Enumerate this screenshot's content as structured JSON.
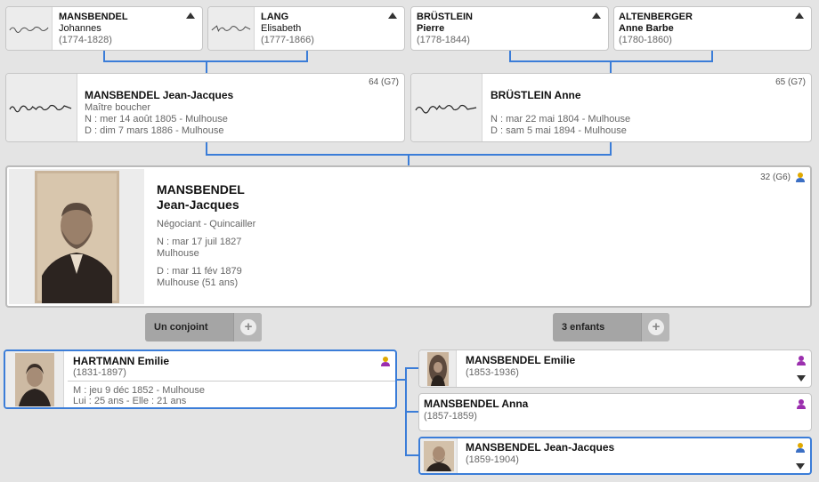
{
  "grandparents": [
    {
      "last": "MANSBENDEL",
      "first": "Johannes",
      "dates": "(1774-1828)"
    },
    {
      "last": "LANG",
      "first": "Elisabeth",
      "dates": "(1777-1866)"
    },
    {
      "last": "BRÜSTLEIN",
      "first": "Pierre",
      "dates": "(1778-1844)"
    },
    {
      "last": "ALTENBERGER",
      "first": "Anne Barbe",
      "dates": "(1780-1860)"
    }
  ],
  "father": {
    "name": "MANSBENDEL Jean-Jacques",
    "gen": "64 (G7)",
    "occupation": "Maître boucher",
    "birth": "N : mer 14 août 1805 - Mulhouse",
    "death": "D : dim 7 mars 1886 - Mulhouse",
    "signature": "Jean Jacques Mansbendel"
  },
  "mother": {
    "name": "BRÜSTLEIN Anne",
    "gen": "65 (G7)",
    "birth": "N : mar 22 mai 1804 - Mulhouse",
    "death": "D : sam 5 mai 1894 - Mulhouse",
    "signature": "Anna Brüstlein"
  },
  "main": {
    "last": "MANSBENDEL",
    "first": "Jean-Jacques",
    "gen": "32 (G6)",
    "occupation": "Négociant - Quincailler",
    "birth_line1": "N : mar 17 juil 1827",
    "birth_line2": "Mulhouse",
    "death_line1": "D : mar 11 fév 1879",
    "death_line2": "Mulhouse (51 ans)"
  },
  "buttons": {
    "spouses": "Un conjoint",
    "children": "3 enfants",
    "plus": "+"
  },
  "spouse": {
    "name": "HARTMANN Emilie",
    "dates": "(1831-1897)",
    "marriage": "M : jeu 9 déc 1852 - Mulhouse",
    "ages": "Lui : 25 ans - Elle : 21 ans"
  },
  "children": [
    {
      "name": "MANSBENDEL Emilie",
      "dates": "(1853-1936)"
    },
    {
      "name": "MANSBENDEL Anna",
      "dates": "(1857-1859)"
    },
    {
      "name": "MANSBENDEL Jean-Jacques",
      "dates": "(1859-1904)"
    }
  ],
  "colors": {
    "accent": "#3b7dd8",
    "male": "#e0a800",
    "female": "#9b2fae"
  }
}
